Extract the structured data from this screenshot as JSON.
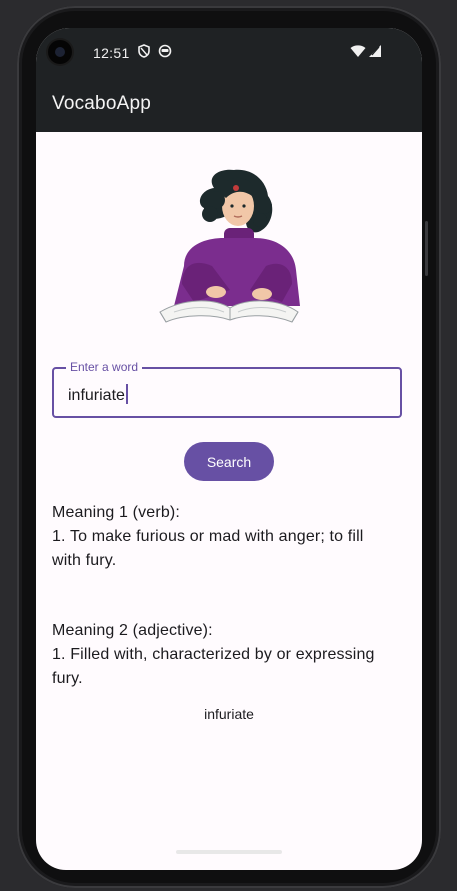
{
  "status_bar": {
    "time": "12:51",
    "left_icons": [
      "shield-icon",
      "app-notification-icon"
    ],
    "right_icons": [
      "wifi-icon",
      "cellular-signal-icon"
    ]
  },
  "app_bar": {
    "title": "VocaboApp"
  },
  "illustration": {
    "icon": "person-reading-book-illustration",
    "colors": {
      "sweater": "#7b2d8e",
      "hair": "#1d2a2c",
      "skin": "#f1c7a8"
    }
  },
  "search": {
    "label": "Enter a word",
    "value": "infuriate",
    "button_label": "Search"
  },
  "meanings": [
    {
      "heading": "Meaning 1 (verb):",
      "definition": "1. To make furious or mad with anger; to fill with fury."
    },
    {
      "heading": "Meaning 2 (adjective):",
      "definition": "1. Filled with, characterized by or expressing fury."
    }
  ],
  "word_footer": "infuriate",
  "colors": {
    "primary": "#6750a4",
    "app_bar": "#1f2224",
    "background": "#fffbfe"
  }
}
